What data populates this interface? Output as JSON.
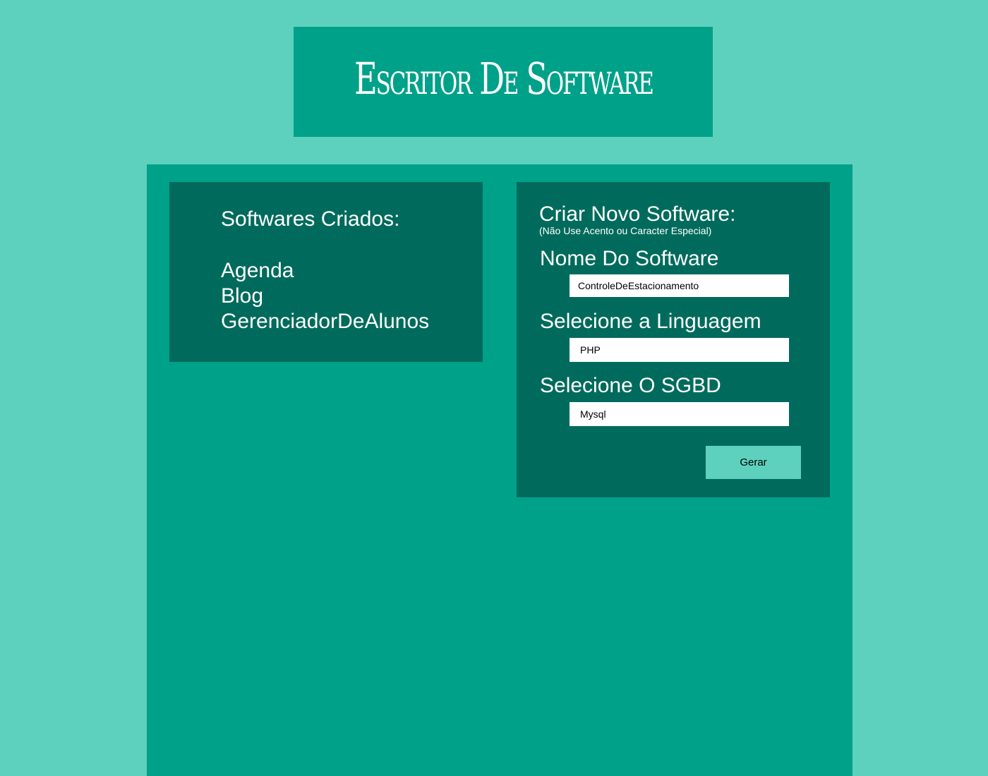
{
  "header": {
    "title": "Escritor De Software"
  },
  "softwares_panel": {
    "heading": "Softwares Criados:",
    "items": [
      "Agenda",
      "Blog",
      "GerenciadorDeAlunos"
    ]
  },
  "create_panel": {
    "heading": "Criar Novo Software:",
    "note": "(Não Use Acento ou Caracter Especial)",
    "name_field": {
      "label": "Nome Do Software",
      "value": "ControleDeEstacionamento"
    },
    "language_field": {
      "label": "Selecione a Linguagem",
      "selected": "PHP"
    },
    "sgbd_field": {
      "label": "Selecione O SGBD",
      "selected": "Mysql"
    },
    "submit_label": "Gerar"
  },
  "colors": {
    "page_background": "#5ed1be",
    "header_background": "#00a189",
    "main_background": "#00a189",
    "panel_background": "#006b5c",
    "button_background": "#5ed1be",
    "text_light": "#ffffff"
  }
}
